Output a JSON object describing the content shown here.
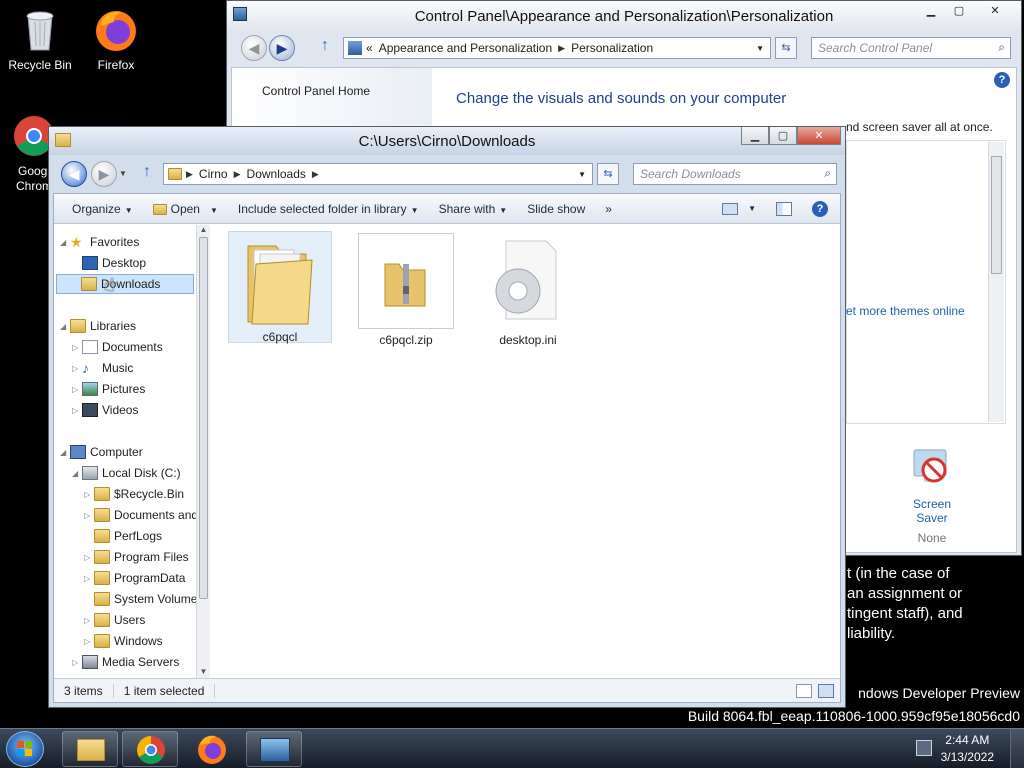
{
  "desktop": {
    "icons": [
      {
        "label": "Recycle Bin"
      },
      {
        "label": "Firefox"
      },
      {
        "label": "Googl\nChrom"
      }
    ],
    "bg_text_lines": [
      "t (in the case of",
      "an assignment or",
      "tingent staff), and",
      "liability."
    ],
    "developer_preview": "ndows Developer Preview",
    "build": "Build 8064.fbl_eeap.110806-1000.959cf95e18056cd0"
  },
  "control_panel": {
    "title": "Control Panel\\Appearance and Personalization\\Personalization",
    "breadcrumb": [
      "Appearance and Personalization",
      "Personalization"
    ],
    "breadcrumb_prefix": "«",
    "search_placeholder": "Search Control Panel",
    "home_link": "Control Panel Home",
    "heading": "Change the visuals and sounds on your computer",
    "subtext_partial": "nd screen saver all at once.",
    "themes_link": "et more themes online",
    "screen_saver_label": "Screen Saver",
    "screen_saver_value": "None"
  },
  "explorer": {
    "title": "C:\\Users\\Cirno\\Downloads",
    "breadcrumb": [
      "Cirno",
      "Downloads"
    ],
    "search_placeholder": "Search Downloads",
    "commands": [
      "Organize",
      "Open",
      "Include selected folder in library",
      "Share with",
      "Slide show",
      "»"
    ],
    "tree": [
      {
        "label": "Favorites",
        "level": 0,
        "expander": "◢"
      },
      {
        "label": "Desktop",
        "level": 1
      },
      {
        "label": "Downloads",
        "level": 1,
        "selected": true
      },
      {
        "label": "Libraries",
        "level": 0,
        "expander": "◢"
      },
      {
        "label": "Documents",
        "level": 1,
        "expander": "▷"
      },
      {
        "label": "Music",
        "level": 1,
        "expander": "▷"
      },
      {
        "label": "Pictures",
        "level": 1,
        "expander": "▷"
      },
      {
        "label": "Videos",
        "level": 1,
        "expander": "▷"
      },
      {
        "label": "Computer",
        "level": 0,
        "expander": "◢"
      },
      {
        "label": "Local Disk (C:)",
        "level": 1,
        "expander": "◢"
      },
      {
        "label": "$Recycle.Bin",
        "level": 2,
        "expander": "▷"
      },
      {
        "label": "Documents and",
        "level": 2,
        "expander": "▷"
      },
      {
        "label": "PerfLogs",
        "level": 2
      },
      {
        "label": "Program Files",
        "level": 2,
        "expander": "▷"
      },
      {
        "label": "ProgramData",
        "level": 2,
        "expander": "▷"
      },
      {
        "label": "System Volume",
        "level": 2
      },
      {
        "label": "Users",
        "level": 2,
        "expander": "▷"
      },
      {
        "label": "Windows",
        "level": 2,
        "expander": "▷"
      },
      {
        "label": "Media Servers",
        "level": 1,
        "expander": "▷"
      }
    ],
    "files": [
      {
        "name": "c6pqcl",
        "type": "folder",
        "selected": true
      },
      {
        "name": "c6pqcl.zip",
        "type": "zip"
      },
      {
        "name": "desktop.ini",
        "type": "ini"
      }
    ],
    "status_count": "3 items",
    "status_selected": "1 item selected"
  },
  "taskbar": {
    "time": "2:44 AM",
    "date": "3/13/2022"
  }
}
